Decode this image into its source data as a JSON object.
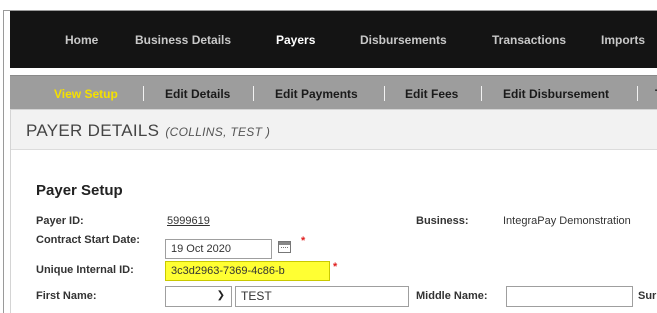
{
  "top_nav": [
    {
      "label": "Home",
      "active": false
    },
    {
      "label": "Business Details",
      "active": false
    },
    {
      "label": "Payers",
      "active": true
    },
    {
      "label": "Disbursements",
      "active": false
    },
    {
      "label": "Transactions",
      "active": false
    },
    {
      "label": "Imports",
      "active": false
    }
  ],
  "sub_nav": [
    {
      "label": "View Setup",
      "active": true
    },
    {
      "label": "Edit Details",
      "active": false
    },
    {
      "label": "Edit Payments",
      "active": false
    },
    {
      "label": "Edit Fees",
      "active": false
    },
    {
      "label": "Edit Disbursement",
      "active": false
    },
    {
      "label": "T",
      "active": false
    }
  ],
  "page": {
    "title": "PAYER DETAILS",
    "subtitle": "(COLLINS, TEST )"
  },
  "section": {
    "title": "Payer Setup"
  },
  "form": {
    "payer_id_label": "Payer ID:",
    "payer_id_value": "5999619",
    "business_label": "Business:",
    "business_value": "IntegraPay Demonstration",
    "contract_start_label": "Contract Start Date:",
    "contract_start_value": "19 Oct 2020",
    "unique_internal_id_label": "Unique Internal ID:",
    "unique_internal_id_value": "3c3d2963-7369-4c86-b",
    "first_name_label": "First Name:",
    "title_select_value": "",
    "first_name_value": "TEST",
    "middle_name_label": "Middle Name:",
    "middle_name_value": "",
    "surname_label": "Surn",
    "required_marker": "*"
  },
  "colors": {
    "top_nav_bg": "#141414",
    "sub_nav_bg": "#9d9d9d",
    "active_sub_nav": "#f5e000",
    "highlight": "#ffff33",
    "required": "#e02020"
  },
  "icons": {
    "calendar": "calendar-icon",
    "dropdown": "chevron-down-icon"
  }
}
